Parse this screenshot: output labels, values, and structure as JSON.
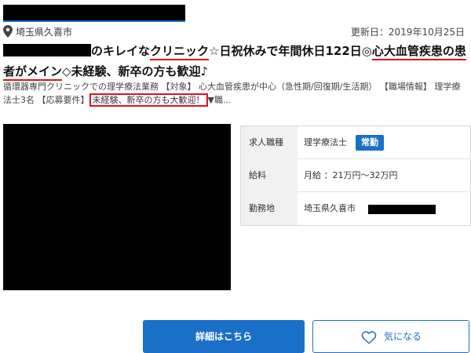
{
  "header": {
    "location": "埼玉県久喜市",
    "updated": "更新日：2019年10月25日"
  },
  "title": {
    "part1": "のキレイな",
    "part2": "クリニック",
    "part3": "☆日祝休みで年間休日122日◎",
    "part4": "心大血管疾患の患",
    "part5": "者がメイン",
    "part6": "◇未経験、新卒の方も歓迎♪"
  },
  "summary": {
    "text1": "循環器専門クリニックでの理学療法業務 【対象】 心大血管疾患が中心（急性期/回復期/生活期） 【職場情報】 理学療法士3名 【応募要件】",
    "highlight": "未経験、新卒の方も大歓迎！",
    "text2": "▼職..."
  },
  "info": {
    "rows": [
      {
        "label": "求人職種",
        "value": "理学療法士",
        "badge": "常勤"
      },
      {
        "label": "給料",
        "value": "月給 ：21万円〜32万円"
      },
      {
        "label": "勤務地",
        "value": "埼玉県久喜市"
      }
    ]
  },
  "buttons": {
    "detail": "詳細はこちら",
    "favorite": "気になる"
  },
  "icons": {
    "location": "map-pin-icon",
    "favorite": "heart-icon"
  },
  "colors": {
    "accent": "#1a6fc9",
    "highlight": "#e01020"
  }
}
